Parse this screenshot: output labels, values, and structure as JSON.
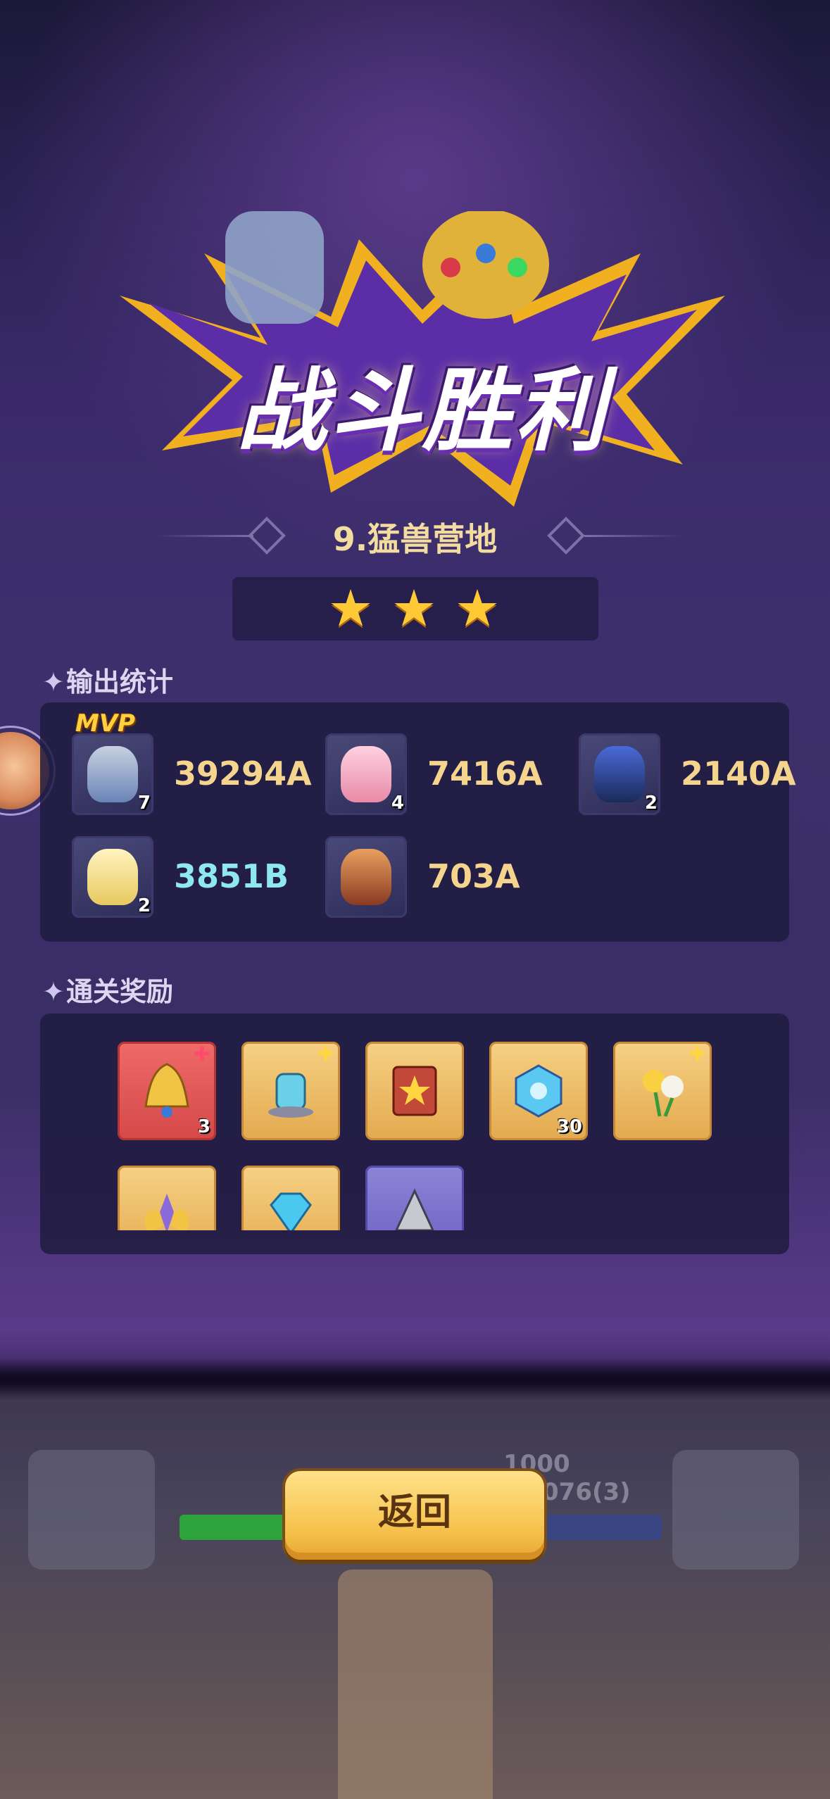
{
  "banner": {
    "title": "战斗胜利"
  },
  "stage": {
    "name": "9.猛兽营地",
    "stars": 3,
    "max_stars": 3
  },
  "damage_section": {
    "title": "输出统计",
    "mvp_label": "MVP",
    "heroes": [
      {
        "level": "7",
        "damage": "39294A",
        "mvp": true,
        "icon": "thor-hammer-hero-icon"
      },
      {
        "level": "4",
        "damage": "7416A",
        "mvp": false,
        "icon": "pink-cat-hero-icon"
      },
      {
        "level": "2",
        "damage": "2140A",
        "mvp": false,
        "icon": "dark-knight-hero-icon"
      },
      {
        "level": "2",
        "damage": "3851B",
        "mvp": false,
        "icon": "angel-hero-icon"
      },
      {
        "level": "",
        "damage": "703A",
        "mvp": false,
        "icon": "king-sword-hero-icon"
      }
    ]
  },
  "reward_section": {
    "title": "通关奖励",
    "items": [
      {
        "icon": "golden-bell-icon",
        "count": "3",
        "frame": "red",
        "fragment": "red"
      },
      {
        "icon": "crystal-tower-icon",
        "count": "",
        "frame": "gold",
        "fragment": "yellow"
      },
      {
        "icon": "star-book-icon",
        "count": "",
        "frame": "gold",
        "fragment": ""
      },
      {
        "icon": "blue-cube-icon",
        "count": "30",
        "frame": "gold",
        "fragment": ""
      },
      {
        "icon": "flower-bouquet-icon",
        "count": "",
        "frame": "gold",
        "fragment": "yellow"
      },
      {
        "icon": "golden-wings-icon",
        "count": "",
        "frame": "gold",
        "fragment": ""
      },
      {
        "icon": "blue-diamond-icon",
        "count": "",
        "frame": "gold",
        "fragment": ""
      },
      {
        "icon": "silver-stone-icon",
        "count": "",
        "frame": "purple",
        "fragment": ""
      }
    ]
  },
  "back_button": {
    "label": "返回"
  },
  "background_battle": {
    "value1": "1000",
    "value2": "076(3)"
  },
  "colors": {
    "gold_text": "#f5d58e",
    "cyan_text": "#8fe8f0",
    "panel": "#1e1b40",
    "button": "#f5c04a"
  }
}
